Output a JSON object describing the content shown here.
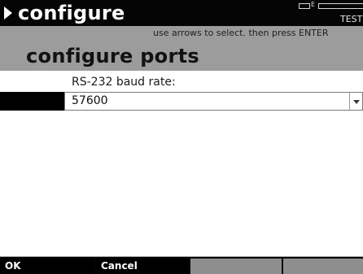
{
  "title_bar": {
    "title": "configure",
    "battery_letter": "E",
    "mode": "TEST"
  },
  "header": {
    "hint": "use arrows to select. then press ENTER",
    "page_title": "configure ports"
  },
  "form": {
    "baud_rate": {
      "label": "RS-232 baud rate:",
      "value": "57600"
    }
  },
  "softkeys": [
    {
      "label": "OK"
    },
    {
      "label": "Cancel"
    },
    {
      "label": ""
    },
    {
      "label": ""
    }
  ],
  "colors": {
    "title_bar_bg": "#050505",
    "header_bg": "#9c9c9c",
    "softkey_active_bg": "#000000",
    "softkey_inactive_bg": "#8e8e8e"
  },
  "icons": {
    "title_marker": "triangle-right-icon",
    "battery": "battery-icon",
    "dropdown": "chevron-down-icon"
  }
}
